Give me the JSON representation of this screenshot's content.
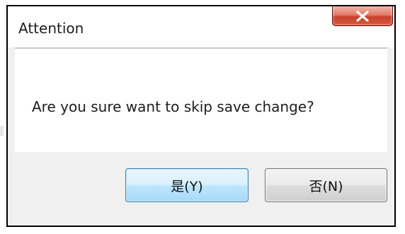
{
  "dialog": {
    "title": "Attention",
    "message": "Are you sure want to skip save change?",
    "close_icon": "close-x-icon",
    "buttons": {
      "yes_label": "是(Y)",
      "no_label": "否(N)"
    }
  },
  "colors": {
    "close_button": "#c8412b",
    "default_button_border": "#3c7fb1",
    "dialog_background": "#f0f0f0"
  }
}
